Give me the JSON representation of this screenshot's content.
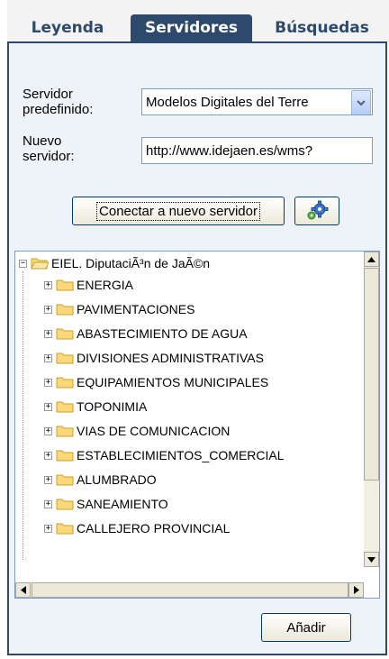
{
  "tabs": [
    "Leyenda",
    "Servidores",
    "Búsquedas"
  ],
  "form": {
    "predef_label": "Servidor predefinido:",
    "predef_value": "Modelos Digitales del Terre",
    "new_label": "Nuevo servidor:",
    "new_value": "http://www.idejaen.es/wms?",
    "connect_label": "Conectar a nuevo servidor"
  },
  "tree": {
    "root": "EIEL. DiputaciÃ³n de JaÃ©n",
    "items": [
      "ENERGIA",
      "PAVIMENTACIONES",
      "ABASTECIMIENTO DE AGUA",
      "DIVISIONES ADMINISTRATIVAS",
      "EQUIPAMIENTOS MUNICIPALES",
      "TOPONIMIA",
      "VIAS DE COMUNICACION",
      "ESTABLECIMIENTOS_COMERCIAL",
      "ALUMBRADO",
      "SANEAMIENTO",
      "CALLEJERO PROVINCIAL"
    ]
  },
  "add_label": "Añadir",
  "colors": {
    "accent": "#2d4a6d",
    "panel_bg": "#eef3f7",
    "folder": "#fcd87a"
  }
}
